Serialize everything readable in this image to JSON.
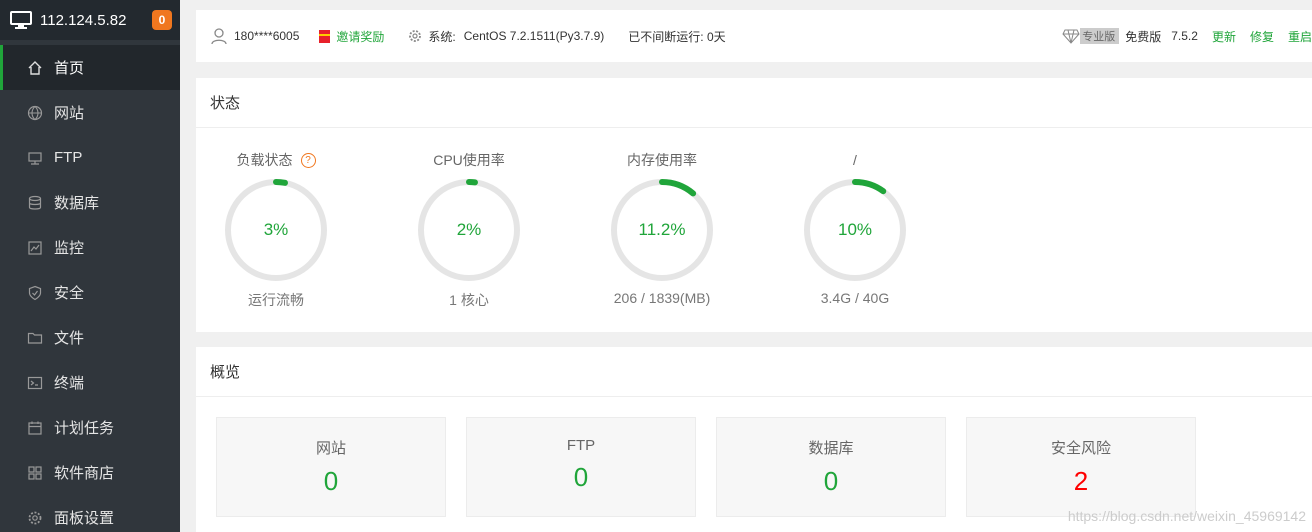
{
  "sidebar": {
    "ip": "112.124.5.82",
    "badge": "0",
    "items": [
      {
        "label": "首页",
        "icon": "home-icon"
      },
      {
        "label": "网站",
        "icon": "globe-icon"
      },
      {
        "label": "FTP",
        "icon": "ftp-icon"
      },
      {
        "label": "数据库",
        "icon": "database-icon"
      },
      {
        "label": "监控",
        "icon": "monitor-chart-icon"
      },
      {
        "label": "安全",
        "icon": "shield-icon"
      },
      {
        "label": "文件",
        "icon": "folder-icon"
      },
      {
        "label": "终端",
        "icon": "terminal-icon"
      },
      {
        "label": "计划任务",
        "icon": "calendar-icon"
      },
      {
        "label": "软件商店",
        "icon": "apps-grid-icon"
      },
      {
        "label": "面板设置",
        "icon": "gear-icon"
      }
    ]
  },
  "topbar": {
    "user": "180****6005",
    "invite": "邀请奖励",
    "sys_label": "系统:",
    "sys_value": "CentOS 7.2.1511(Py3.7.9)",
    "uptime": "已不间断运行: 0天",
    "pro": "专业版",
    "free": "免费版",
    "version": "7.5.2",
    "update": "更新",
    "repair": "修复",
    "restart": "重启"
  },
  "status": {
    "title": "状态",
    "gauges": [
      {
        "title": "负载状态",
        "value": "3%",
        "percent": 3,
        "sub": "运行流畅",
        "help": "?"
      },
      {
        "title": "CPU使用率",
        "value": "2%",
        "percent": 2,
        "sub": "1 核心"
      },
      {
        "title": "内存使用率",
        "value": "11.2%",
        "percent": 11.2,
        "sub": "206 / 1839(MB)"
      },
      {
        "title": "/",
        "value": "10%",
        "percent": 10,
        "sub": "3.4G / 40G"
      }
    ]
  },
  "overview": {
    "title": "概览",
    "cards": [
      {
        "title": "网站",
        "value": "0"
      },
      {
        "title": "FTP",
        "value": "0"
      },
      {
        "title": "数据库",
        "value": "0"
      },
      {
        "title": "安全风险",
        "value": "2"
      }
    ]
  },
  "watermark": "https://blog.csdn.net/weixin_45969142",
  "colors": {
    "accent": "#20a53a",
    "sidebar": "#30363c",
    "risk": "#ff0000",
    "badge": "#f0771f"
  }
}
